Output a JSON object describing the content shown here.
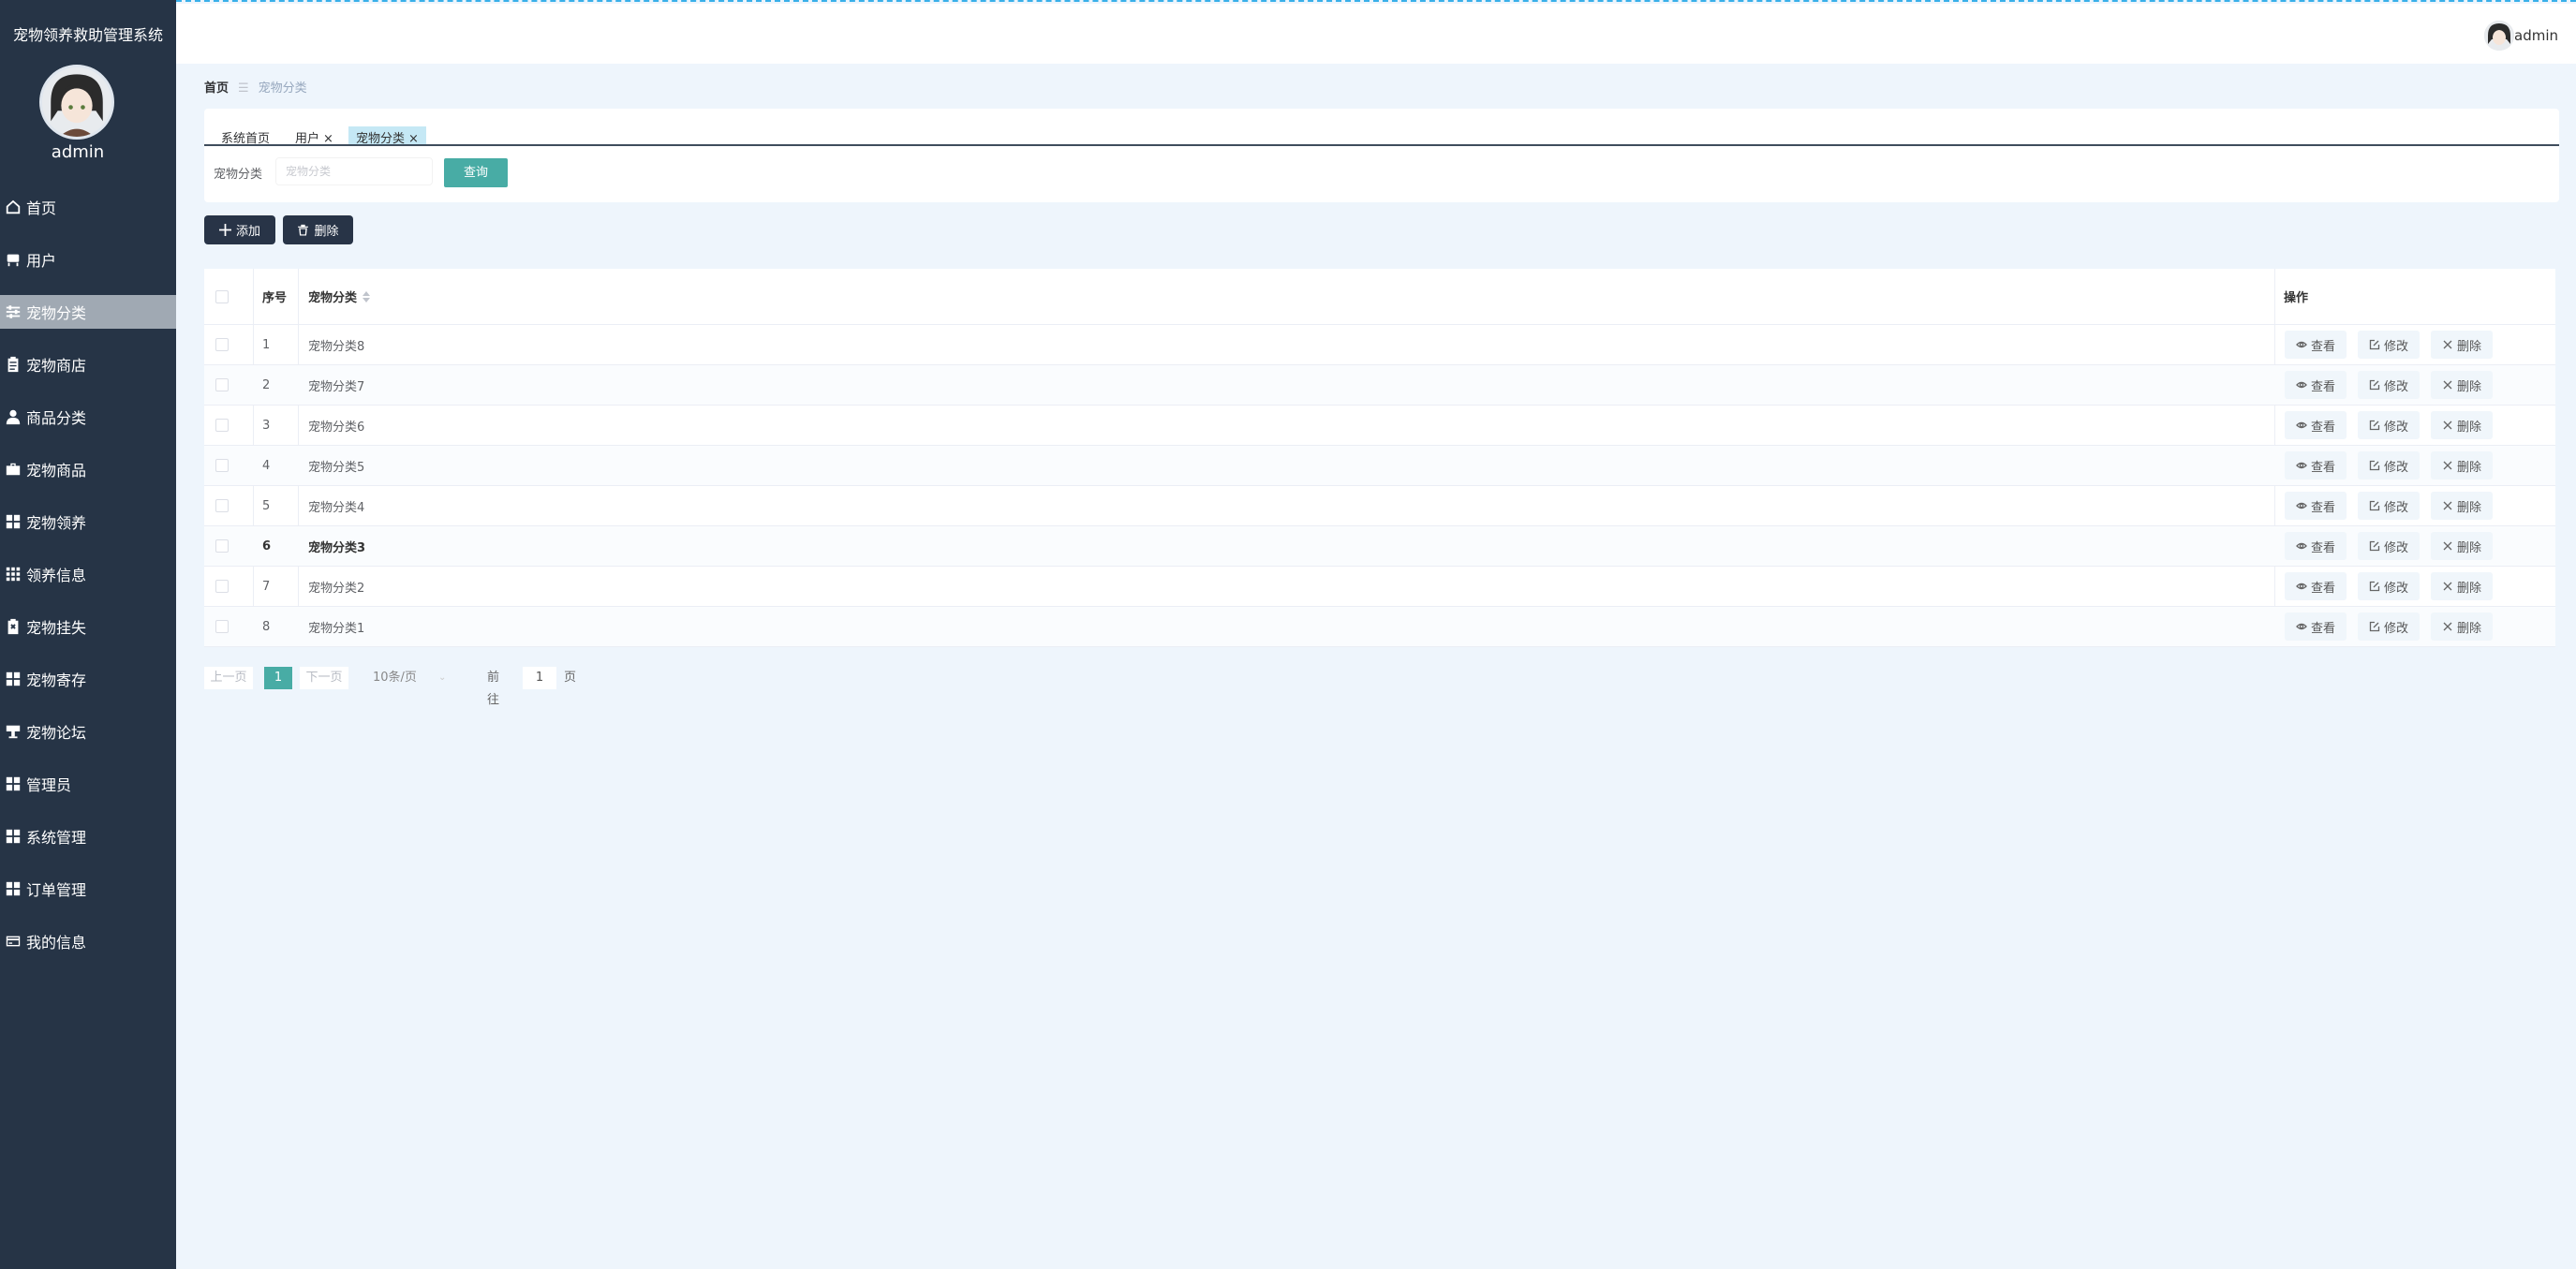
{
  "app": {
    "title": "宠物领养救助管理系统",
    "admin_name": "admin"
  },
  "header": {
    "user_name": "admin"
  },
  "sidebar": {
    "items": [
      {
        "label": "首页",
        "icon": "home-icon"
      },
      {
        "label": "用户",
        "icon": "chair-icon"
      },
      {
        "label": "宠物分类",
        "icon": "sliders-icon",
        "active": true
      },
      {
        "label": "宠物商店",
        "icon": "clipboard-icon"
      },
      {
        "label": "商品分类",
        "icon": "user-icon"
      },
      {
        "label": "宠物商品",
        "icon": "briefcase-icon"
      },
      {
        "label": "宠物领养",
        "icon": "grid-icon"
      },
      {
        "label": "领养信息",
        "icon": "apps-icon"
      },
      {
        "label": "宠物挂失",
        "icon": "clipboard-x-icon"
      },
      {
        "label": "宠物寄存",
        "icon": "grid-icon"
      },
      {
        "label": "宠物论坛",
        "icon": "podium-icon"
      },
      {
        "label": "管理员",
        "icon": "grid-icon"
      },
      {
        "label": "系统管理",
        "icon": "grid-icon"
      },
      {
        "label": "订单管理",
        "icon": "grid-icon"
      },
      {
        "label": "我的信息",
        "icon": "card-icon"
      }
    ]
  },
  "breadcrumb": {
    "home": "首页",
    "separator": "☰",
    "current": "宠物分类"
  },
  "tags": [
    {
      "label": "系统首页",
      "closable": false
    },
    {
      "label": "用户",
      "closable": true
    },
    {
      "label": "宠物分类",
      "closable": true,
      "active": true
    }
  ],
  "search": {
    "label": "宠物分类",
    "placeholder": "宠物分类",
    "value": "",
    "button": "查询"
  },
  "toolbar": {
    "add_label": "添加",
    "delete_label": "删除"
  },
  "table": {
    "columns": [
      "序号",
      "宠物分类",
      "操作"
    ],
    "rows": [
      {
        "index": "1",
        "name": "宠物分类8"
      },
      {
        "index": "2",
        "name": "宠物分类7"
      },
      {
        "index": "3",
        "name": "宠物分类6"
      },
      {
        "index": "4",
        "name": "宠物分类5"
      },
      {
        "index": "5",
        "name": "宠物分类4"
      },
      {
        "index": "6",
        "name": "宠物分类3"
      },
      {
        "index": "7",
        "name": "宠物分类2"
      },
      {
        "index": "8",
        "name": "宠物分类1"
      }
    ],
    "actions": {
      "view": "查看",
      "edit": "修改",
      "delete": "删除"
    }
  },
  "pagination": {
    "prev": "上一页",
    "current": "1",
    "next": "下一页",
    "page_size": "10条/页",
    "goto_label": "前往",
    "goto_value": "1",
    "page_suffix": "页"
  },
  "colors": {
    "sidebar_bg": "#263446",
    "accent": "#48aca5",
    "page_bg": "#eef5fc",
    "active_menu": "#a0a9b3"
  }
}
